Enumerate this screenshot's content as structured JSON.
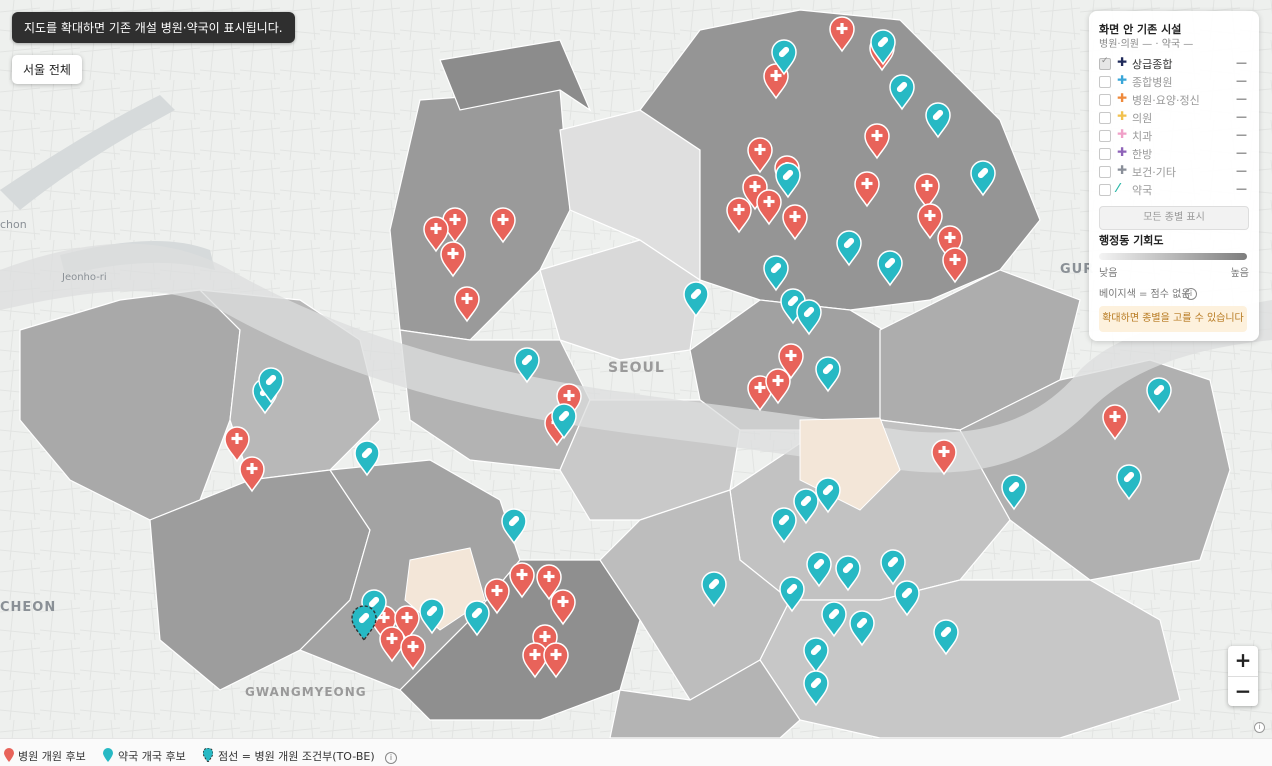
{
  "notice": "지도를 확대하면 기존 개설 병원·약국이 표시됩니다.",
  "seoul_button": "서울 전체",
  "map_labels": {
    "seoul": "SEOUL",
    "gwangmyeong": "GWANGMYEONG",
    "bucheon": "CHEON",
    "gur": "GUR",
    "jeonho": "Jeonho-ri",
    "ilsan": "chon"
  },
  "panel": {
    "title": "화면 안 기존 시설",
    "subtitle": "병원·의원 —  · 약국 —",
    "categories": [
      {
        "label": "상급종합",
        "marker": "✚",
        "color": "#1f2a5a",
        "checked": true,
        "count": "—"
      },
      {
        "label": "종합병원",
        "marker": "✚",
        "color": "#3aa6d8",
        "checked": false,
        "count": "—"
      },
      {
        "label": "병원·요양·정신",
        "marker": "✚",
        "color": "#ef8a3c",
        "checked": false,
        "count": "—"
      },
      {
        "label": "의원",
        "marker": "✚",
        "color": "#f2c14e",
        "checked": false,
        "count": "—"
      },
      {
        "label": "치과",
        "marker": "✚",
        "color": "#f0a0c8",
        "checked": false,
        "count": "—"
      },
      {
        "label": "한방",
        "marker": "✚",
        "color": "#8e63b8",
        "checked": false,
        "count": "—"
      },
      {
        "label": "보건·기타",
        "marker": "✚",
        "color": "#8a8f99",
        "checked": false,
        "count": "—"
      },
      {
        "label": "약국",
        "marker": "⁄",
        "color": "#2cb8a8",
        "checked": false,
        "count": "—"
      }
    ],
    "show_all": "모든 종별 표시",
    "opportunity_title": "행정동 기회도",
    "low": "낮음",
    "high": "높음",
    "beige_note": "베이지색 = 점수 없음",
    "zoom_note": "확대하면 종별을 고를 수 있습니다"
  },
  "zoom": {
    "plus": "+",
    "minus": "−"
  },
  "legend": {
    "hospital": "병원 개원 후보",
    "pharmacy": "약국 개국 후보",
    "dashed": "점선 = 병원 개원 조건부(TO-BE)"
  },
  "colors": {
    "hospital": "#e8635a",
    "pharmacy": "#27b9c4",
    "beige": "#f3e6d8",
    "water": "#d6dadb"
  },
  "markers": {
    "hospital": [
      [
        842,
        37
      ],
      [
        882,
        56
      ],
      [
        776,
        84
      ],
      [
        760,
        158
      ],
      [
        877,
        144
      ],
      [
        787,
        176
      ],
      [
        755,
        195
      ],
      [
        769,
        210
      ],
      [
        739,
        218
      ],
      [
        795,
        225
      ],
      [
        867,
        192
      ],
      [
        927,
        194
      ],
      [
        930,
        224
      ],
      [
        950,
        246
      ],
      [
        955,
        268
      ],
      [
        455,
        228
      ],
      [
        436,
        237
      ],
      [
        503,
        228
      ],
      [
        453,
        262
      ],
      [
        467,
        307
      ],
      [
        791,
        364
      ],
      [
        760,
        396
      ],
      [
        778,
        389
      ],
      [
        569,
        404
      ],
      [
        557,
        431
      ],
      [
        944,
        460
      ],
      [
        1115,
        425
      ],
      [
        237,
        447
      ],
      [
        252,
        477
      ],
      [
        522,
        583
      ],
      [
        549,
        585
      ],
      [
        497,
        599
      ],
      [
        563,
        610
      ],
      [
        545,
        645
      ],
      [
        535,
        663
      ],
      [
        556,
        663
      ],
      [
        384,
        626
      ],
      [
        407,
        626
      ],
      [
        392,
        647
      ],
      [
        413,
        655
      ]
    ],
    "pharmacy": [
      [
        784,
        60
      ],
      [
        883,
        50
      ],
      [
        902,
        95
      ],
      [
        938,
        123
      ],
      [
        983,
        181
      ],
      [
        788,
        183
      ],
      [
        849,
        251
      ],
      [
        890,
        271
      ],
      [
        776,
        276
      ],
      [
        696,
        302
      ],
      [
        793,
        309
      ],
      [
        809,
        320
      ],
      [
        828,
        377
      ],
      [
        527,
        368
      ],
      [
        564,
        424
      ],
      [
        265,
        399
      ],
      [
        271,
        388
      ],
      [
        367,
        461
      ],
      [
        1159,
        398
      ],
      [
        1129,
        485
      ],
      [
        1014,
        495
      ],
      [
        828,
        498
      ],
      [
        806,
        509
      ],
      [
        784,
        528
      ],
      [
        514,
        529
      ],
      [
        714,
        592
      ],
      [
        792,
        597
      ],
      [
        819,
        572
      ],
      [
        848,
        576
      ],
      [
        893,
        570
      ],
      [
        907,
        601
      ],
      [
        834,
        622
      ],
      [
        862,
        631
      ],
      [
        946,
        640
      ],
      [
        816,
        658
      ],
      [
        816,
        691
      ],
      [
        432,
        619
      ],
      [
        477,
        621
      ],
      [
        374,
        610
      ]
    ],
    "dashed": [
      [
        364,
        626
      ]
    ]
  }
}
